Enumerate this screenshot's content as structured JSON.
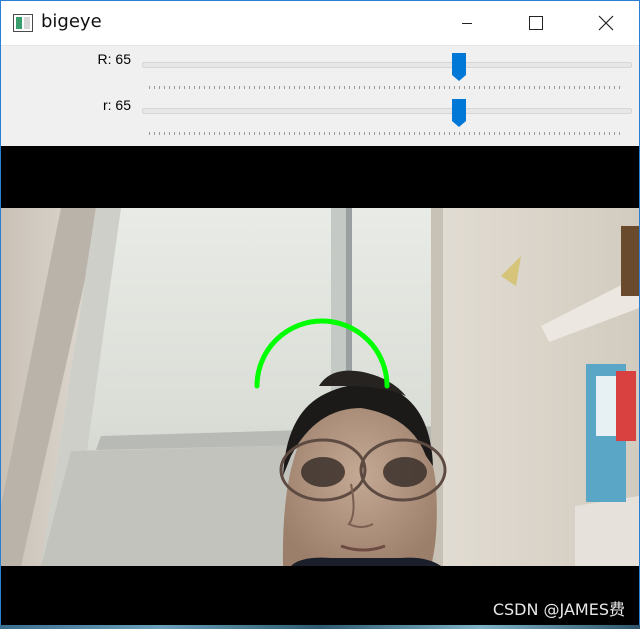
{
  "window": {
    "title": "bigeye",
    "controls": {
      "minimize": "minimize-icon",
      "maximize": "maximize-icon",
      "close": "close-icon"
    }
  },
  "trackbars": [
    {
      "name": "R",
      "label": "R: 65",
      "value": 65,
      "fraction": 0.65
    },
    {
      "name": "r",
      "label": "r: 65",
      "value": 65,
      "fraction": 0.65
    }
  ],
  "video": {
    "arc_color": "#00ff00",
    "watermark": "CSDN @JAMES费"
  },
  "colors": {
    "accent": "#0078d7",
    "window_border": "#2a7fd4"
  }
}
